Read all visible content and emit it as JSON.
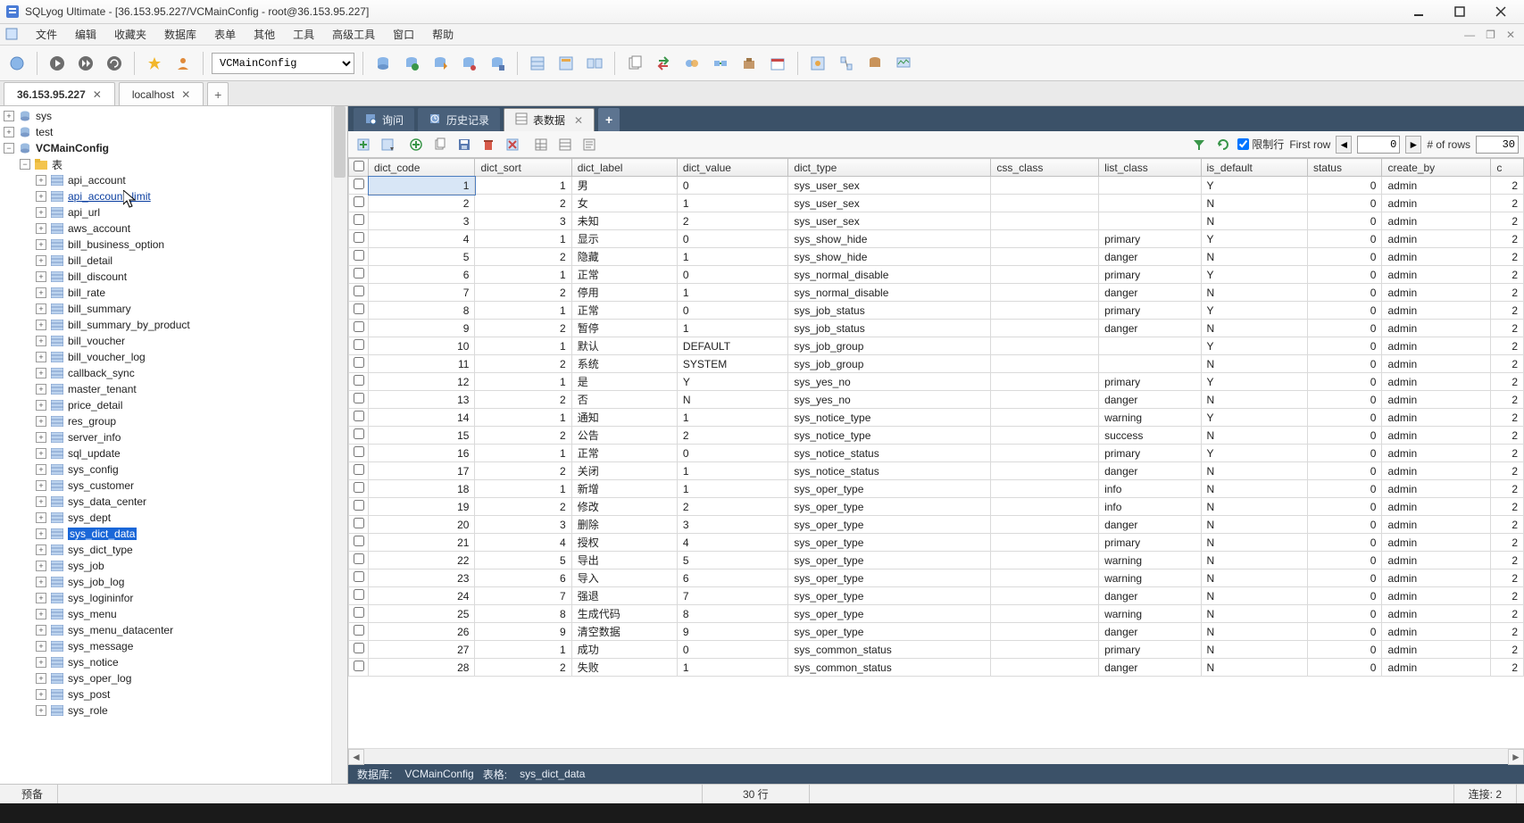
{
  "title": "SQLyog Ultimate - [36.153.95.227/VCMainConfig - root@36.153.95.227]",
  "menus": [
    "文件",
    "编辑",
    "收藏夹",
    "数据库",
    "表单",
    "其他",
    "工具",
    "高级工具",
    "窗口",
    "帮助"
  ],
  "db_combo": "VCMainConfig",
  "conn_tabs": [
    {
      "label": "36.153.95.227",
      "active": true
    },
    {
      "label": "localhost",
      "active": false
    }
  ],
  "tree": {
    "top": [
      {
        "label": "sys"
      },
      {
        "label": "test"
      }
    ],
    "current_db": "VCMainConfig",
    "folder": "表",
    "tables": [
      {
        "label": "api_account"
      },
      {
        "label": "api_account_limit",
        "link": true
      },
      {
        "label": "api_url"
      },
      {
        "label": "aws_account"
      },
      {
        "label": "bill_business_option"
      },
      {
        "label": "bill_detail"
      },
      {
        "label": "bill_discount"
      },
      {
        "label": "bill_rate"
      },
      {
        "label": "bill_summary"
      },
      {
        "label": "bill_summary_by_product"
      },
      {
        "label": "bill_voucher"
      },
      {
        "label": "bill_voucher_log"
      },
      {
        "label": "callback_sync"
      },
      {
        "label": "master_tenant"
      },
      {
        "label": "price_detail"
      },
      {
        "label": "res_group"
      },
      {
        "label": "server_info"
      },
      {
        "label": "sql_update"
      },
      {
        "label": "sys_config"
      },
      {
        "label": "sys_customer"
      },
      {
        "label": "sys_data_center"
      },
      {
        "label": "sys_dept"
      },
      {
        "label": "sys_dict_data",
        "selected": true
      },
      {
        "label": "sys_dict_type"
      },
      {
        "label": "sys_job"
      },
      {
        "label": "sys_job_log"
      },
      {
        "label": "sys_logininfor"
      },
      {
        "label": "sys_menu"
      },
      {
        "label": "sys_menu_datacenter"
      },
      {
        "label": "sys_message"
      },
      {
        "label": "sys_notice"
      },
      {
        "label": "sys_oper_log"
      },
      {
        "label": "sys_post"
      },
      {
        "label": "sys_role"
      }
    ]
  },
  "right_tabs": [
    {
      "icon": "query",
      "label": "询问"
    },
    {
      "icon": "history",
      "label": "历史记录"
    },
    {
      "icon": "data",
      "label": "表数据",
      "active": true,
      "closable": true
    }
  ],
  "paging": {
    "limit_label": "限制行",
    "first_row_label": "First row",
    "first_row": "0",
    "num_rows_label": "# of rows",
    "num_rows": "30"
  },
  "grid": {
    "columns": [
      "dict_code",
      "dict_sort",
      "dict_label",
      "dict_value",
      "dict_type",
      "css_class",
      "list_class",
      "is_default",
      "status",
      "create_by",
      "c"
    ],
    "col_types": [
      "num",
      "num",
      "text",
      "text",
      "text",
      "text",
      "text",
      "text",
      "num",
      "text",
      "num"
    ],
    "rows": [
      [
        "1",
        "1",
        "男",
        "0",
        "sys_user_sex",
        "",
        "",
        "Y",
        "0",
        "admin",
        "2"
      ],
      [
        "2",
        "2",
        "女",
        "1",
        "sys_user_sex",
        "",
        "",
        "N",
        "0",
        "admin",
        "2"
      ],
      [
        "3",
        "3",
        "未知",
        "2",
        "sys_user_sex",
        "",
        "",
        "N",
        "0",
        "admin",
        "2"
      ],
      [
        "4",
        "1",
        "显示",
        "0",
        "sys_show_hide",
        "",
        "primary",
        "Y",
        "0",
        "admin",
        "2"
      ],
      [
        "5",
        "2",
        "隐藏",
        "1",
        "sys_show_hide",
        "",
        "danger",
        "N",
        "0",
        "admin",
        "2"
      ],
      [
        "6",
        "1",
        "正常",
        "0",
        "sys_normal_disable",
        "",
        "primary",
        "Y",
        "0",
        "admin",
        "2"
      ],
      [
        "7",
        "2",
        "停用",
        "1",
        "sys_normal_disable",
        "",
        "danger",
        "N",
        "0",
        "admin",
        "2"
      ],
      [
        "8",
        "1",
        "正常",
        "0",
        "sys_job_status",
        "",
        "primary",
        "Y",
        "0",
        "admin",
        "2"
      ],
      [
        "9",
        "2",
        "暂停",
        "1",
        "sys_job_status",
        "",
        "danger",
        "N",
        "0",
        "admin",
        "2"
      ],
      [
        "10",
        "1",
        "默认",
        "DEFAULT",
        "sys_job_group",
        "",
        "",
        "Y",
        "0",
        "admin",
        "2"
      ],
      [
        "11",
        "2",
        "系统",
        "SYSTEM",
        "sys_job_group",
        "",
        "",
        "N",
        "0",
        "admin",
        "2"
      ],
      [
        "12",
        "1",
        "是",
        "Y",
        "sys_yes_no",
        "",
        "primary",
        "Y",
        "0",
        "admin",
        "2"
      ],
      [
        "13",
        "2",
        "否",
        "N",
        "sys_yes_no",
        "",
        "danger",
        "N",
        "0",
        "admin",
        "2"
      ],
      [
        "14",
        "1",
        "通知",
        "1",
        "sys_notice_type",
        "",
        "warning",
        "Y",
        "0",
        "admin",
        "2"
      ],
      [
        "15",
        "2",
        "公告",
        "2",
        "sys_notice_type",
        "",
        "success",
        "N",
        "0",
        "admin",
        "2"
      ],
      [
        "16",
        "1",
        "正常",
        "0",
        "sys_notice_status",
        "",
        "primary",
        "Y",
        "0",
        "admin",
        "2"
      ],
      [
        "17",
        "2",
        "关闭",
        "1",
        "sys_notice_status",
        "",
        "danger",
        "N",
        "0",
        "admin",
        "2"
      ],
      [
        "18",
        "1",
        "新增",
        "1",
        "sys_oper_type",
        "",
        "info",
        "N",
        "0",
        "admin",
        "2"
      ],
      [
        "19",
        "2",
        "修改",
        "2",
        "sys_oper_type",
        "",
        "info",
        "N",
        "0",
        "admin",
        "2"
      ],
      [
        "20",
        "3",
        "删除",
        "3",
        "sys_oper_type",
        "",
        "danger",
        "N",
        "0",
        "admin",
        "2"
      ],
      [
        "21",
        "4",
        "授权",
        "4",
        "sys_oper_type",
        "",
        "primary",
        "N",
        "0",
        "admin",
        "2"
      ],
      [
        "22",
        "5",
        "导出",
        "5",
        "sys_oper_type",
        "",
        "warning",
        "N",
        "0",
        "admin",
        "2"
      ],
      [
        "23",
        "6",
        "导入",
        "6",
        "sys_oper_type",
        "",
        "warning",
        "N",
        "0",
        "admin",
        "2"
      ],
      [
        "24",
        "7",
        "强退",
        "7",
        "sys_oper_type",
        "",
        "danger",
        "N",
        "0",
        "admin",
        "2"
      ],
      [
        "25",
        "8",
        "生成代码",
        "8",
        "sys_oper_type",
        "",
        "warning",
        "N",
        "0",
        "admin",
        "2"
      ],
      [
        "26",
        "9",
        "清空数据",
        "9",
        "sys_oper_type",
        "",
        "danger",
        "N",
        "0",
        "admin",
        "2"
      ],
      [
        "27",
        "1",
        "成功",
        "0",
        "sys_common_status",
        "",
        "primary",
        "N",
        "0",
        "admin",
        "2"
      ],
      [
        "28",
        "2",
        "失败",
        "1",
        "sys_common_status",
        "",
        "danger",
        "N",
        "0",
        "admin",
        "2"
      ]
    ]
  },
  "grid_status": {
    "db_lbl": "数据库:",
    "db_val": "VCMainConfig",
    "tbl_lbl": "表格:",
    "tbl_val": "sys_dict_data"
  },
  "app_status": {
    "ready": "预备",
    "rows": "30 行",
    "conn": "连接: 2"
  }
}
